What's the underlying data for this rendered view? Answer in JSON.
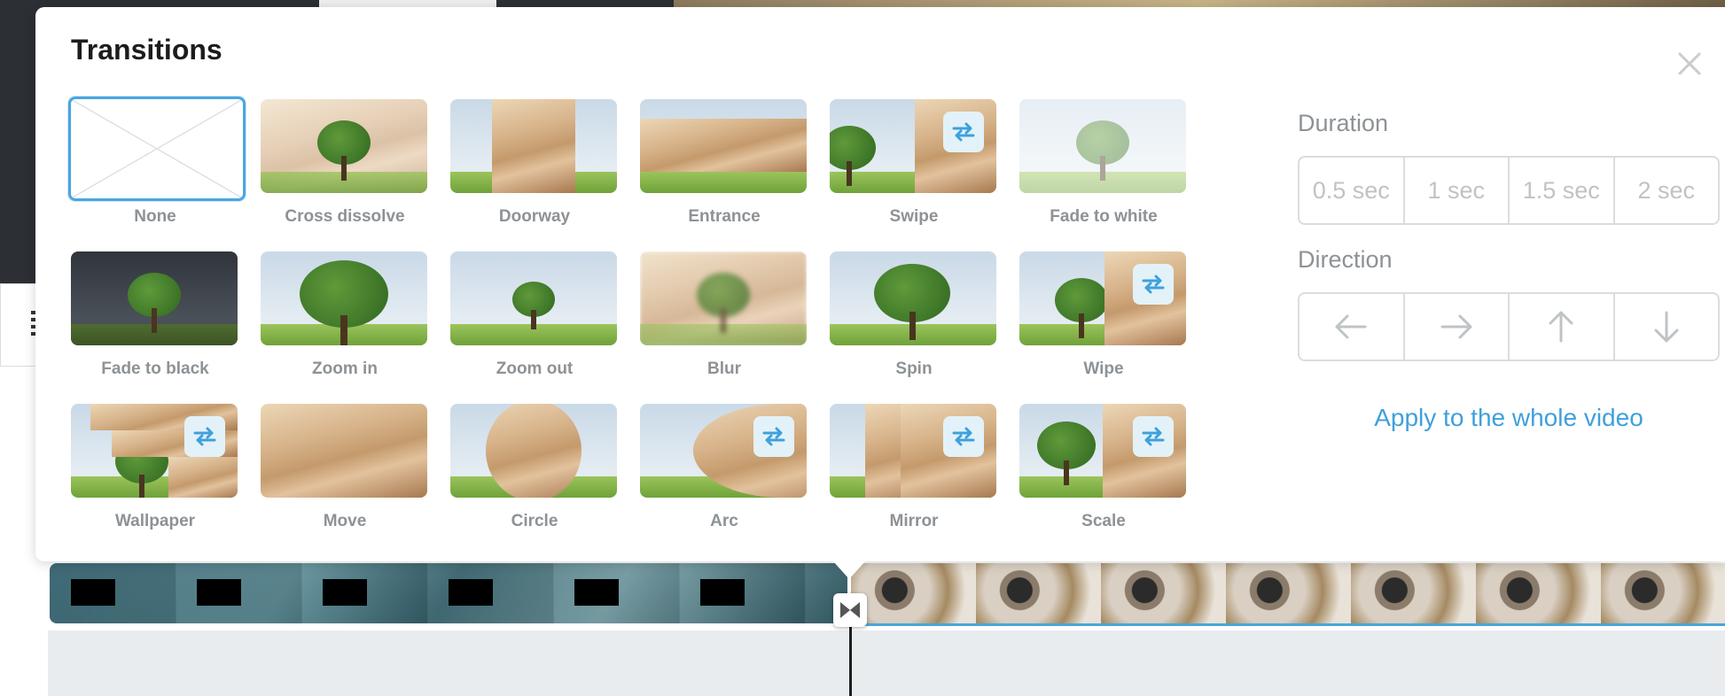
{
  "popup": {
    "title": "Transitions",
    "close_icon": "close-icon"
  },
  "transitions": [
    {
      "id": "none",
      "label": "None",
      "selected": true
    },
    {
      "id": "cross-dissolve",
      "label": "Cross dissolve"
    },
    {
      "id": "doorway",
      "label": "Doorway"
    },
    {
      "id": "entrance",
      "label": "Entrance"
    },
    {
      "id": "swipe",
      "label": "Swipe",
      "has_direction": true
    },
    {
      "id": "fade-to-white",
      "label": "Fade to white"
    },
    {
      "id": "fade-to-black",
      "label": "Fade to black"
    },
    {
      "id": "zoom-in",
      "label": "Zoom in"
    },
    {
      "id": "zoom-out",
      "label": "Zoom out"
    },
    {
      "id": "blur",
      "label": "Blur"
    },
    {
      "id": "spin",
      "label": "Spin"
    },
    {
      "id": "wipe",
      "label": "Wipe",
      "has_direction": true
    },
    {
      "id": "wallpaper",
      "label": "Wallpaper",
      "has_direction": true
    },
    {
      "id": "move",
      "label": "Move"
    },
    {
      "id": "circle",
      "label": "Circle"
    },
    {
      "id": "arc",
      "label": "Arc",
      "has_direction": true
    },
    {
      "id": "mirror",
      "label": "Mirror",
      "has_direction": true
    },
    {
      "id": "scale",
      "label": "Scale",
      "has_direction": true
    }
  ],
  "duration": {
    "label": "Duration",
    "options": [
      "0.5 sec",
      "1 sec",
      "1.5 sec",
      "2 sec"
    ]
  },
  "direction": {
    "label": "Direction",
    "options": [
      "arrow-left-icon",
      "arrow-right-icon",
      "arrow-up-icon",
      "arrow-down-icon"
    ]
  },
  "apply_all_label": "Apply to the whole video",
  "colors": {
    "accent": "#3fa0dc",
    "selected_border": "#4aa6e2",
    "muted_text": "#8d9296",
    "disabled_text": "#bfc3c6",
    "badge_bg": "#e3f2f9"
  }
}
